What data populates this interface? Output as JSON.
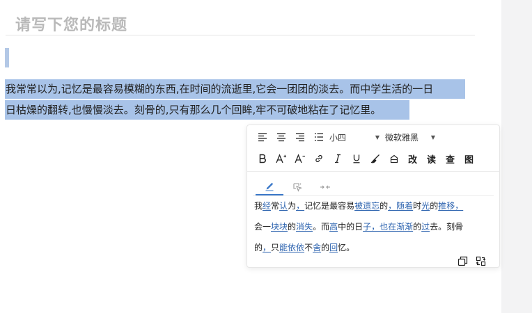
{
  "doc": {
    "title": "请写下您的标题",
    "selected_lines": [
      "我常常以为,记忆是最容易模糊的东西,在时间的流逝里,它会一团团的淡去。而中学生活的一日",
      "日枯燥的翻转,也慢慢淡去。刻骨的,只有那么几个回眸,牢不可破地粘在了记忆里。"
    ]
  },
  "toolbar": {
    "font_size": "小四",
    "font_family": "微软雅黑",
    "correct_label": "改",
    "read_label": "读",
    "check_label": "查",
    "image_label": "图",
    "icons": [
      "align-left-icon",
      "align-center-icon",
      "align-right-icon",
      "list-icon",
      "bold-icon",
      "font-increase-icon",
      "font-decrease-icon",
      "link-icon",
      "italic-icon",
      "underline-icon",
      "brush-icon",
      "eraser-icon"
    ]
  },
  "suggestions": {
    "lines": [
      [
        {
          "t": "我"
        },
        {
          "t": "经",
          "c": true
        },
        {
          "t": "常"
        },
        {
          "t": "认",
          "c": true
        },
        {
          "t": "为"
        },
        {
          "t": "，",
          "c": true
        },
        {
          "t": "记忆是最容易"
        },
        {
          "t": "被遗忘",
          "c": true
        },
        {
          "t": "的"
        },
        {
          "t": "，随着",
          "c": true
        },
        {
          "t": "时"
        },
        {
          "t": "光",
          "c": true
        },
        {
          "t": "的"
        },
        {
          "t": "推移，",
          "c": true
        }
      ],
      [
        {
          "t": "会一"
        },
        {
          "t": "块块",
          "c": true
        },
        {
          "t": "的"
        },
        {
          "t": "消失",
          "c": true
        },
        {
          "t": "。而"
        },
        {
          "t": "高",
          "c": true
        },
        {
          "t": "中的日"
        },
        {
          "t": "子，也在渐渐",
          "c": true
        },
        {
          "t": "的"
        },
        {
          "t": "过",
          "c": true
        },
        {
          "t": "去。刻骨"
        }
      ],
      [
        {
          "t": "的"
        },
        {
          "t": "，",
          "c": true
        },
        {
          "t": "只"
        },
        {
          "t": "能依依",
          "c": true
        },
        {
          "t": "不"
        },
        {
          "t": "舍",
          "c": true
        },
        {
          "t": "的"
        },
        {
          "t": "回",
          "c": true
        },
        {
          "t": "忆。"
        }
      ]
    ]
  },
  "colors": {
    "selection": "#a8c3e8",
    "accent": "#3a78c9",
    "change_text": "#2f65b0",
    "gutter": "#f3f3f4"
  }
}
